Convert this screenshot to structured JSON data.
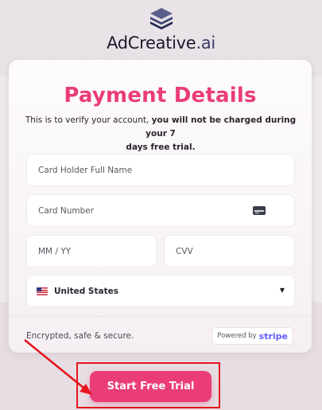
{
  "brand": {
    "name": "AdCreative",
    "suffix": ".ai",
    "logo_icon": "stacked-layers-icon"
  },
  "payment": {
    "title": "Payment Details",
    "subtitle_prefix": "This is to verify your account, ",
    "subtitle_bold": "you will not be charged during your 7",
    "subtitle_line2": "days free trial.",
    "fields": {
      "card_holder": "Card Holder Full Name",
      "card_number": "Card Number",
      "expiry": "MM / YY",
      "cvv": "CVV"
    },
    "country": {
      "value": "United States",
      "flag": "us-flag-icon"
    },
    "security_note": "Encrypted, safe & secure.",
    "powered_by": "Powered by",
    "stripe": "stripe"
  },
  "cta": {
    "label": "Start Free Trial"
  },
  "colors": {
    "accent": "#ea3d78",
    "highlight_red": "#e8141c",
    "stripe": "#635bff"
  }
}
